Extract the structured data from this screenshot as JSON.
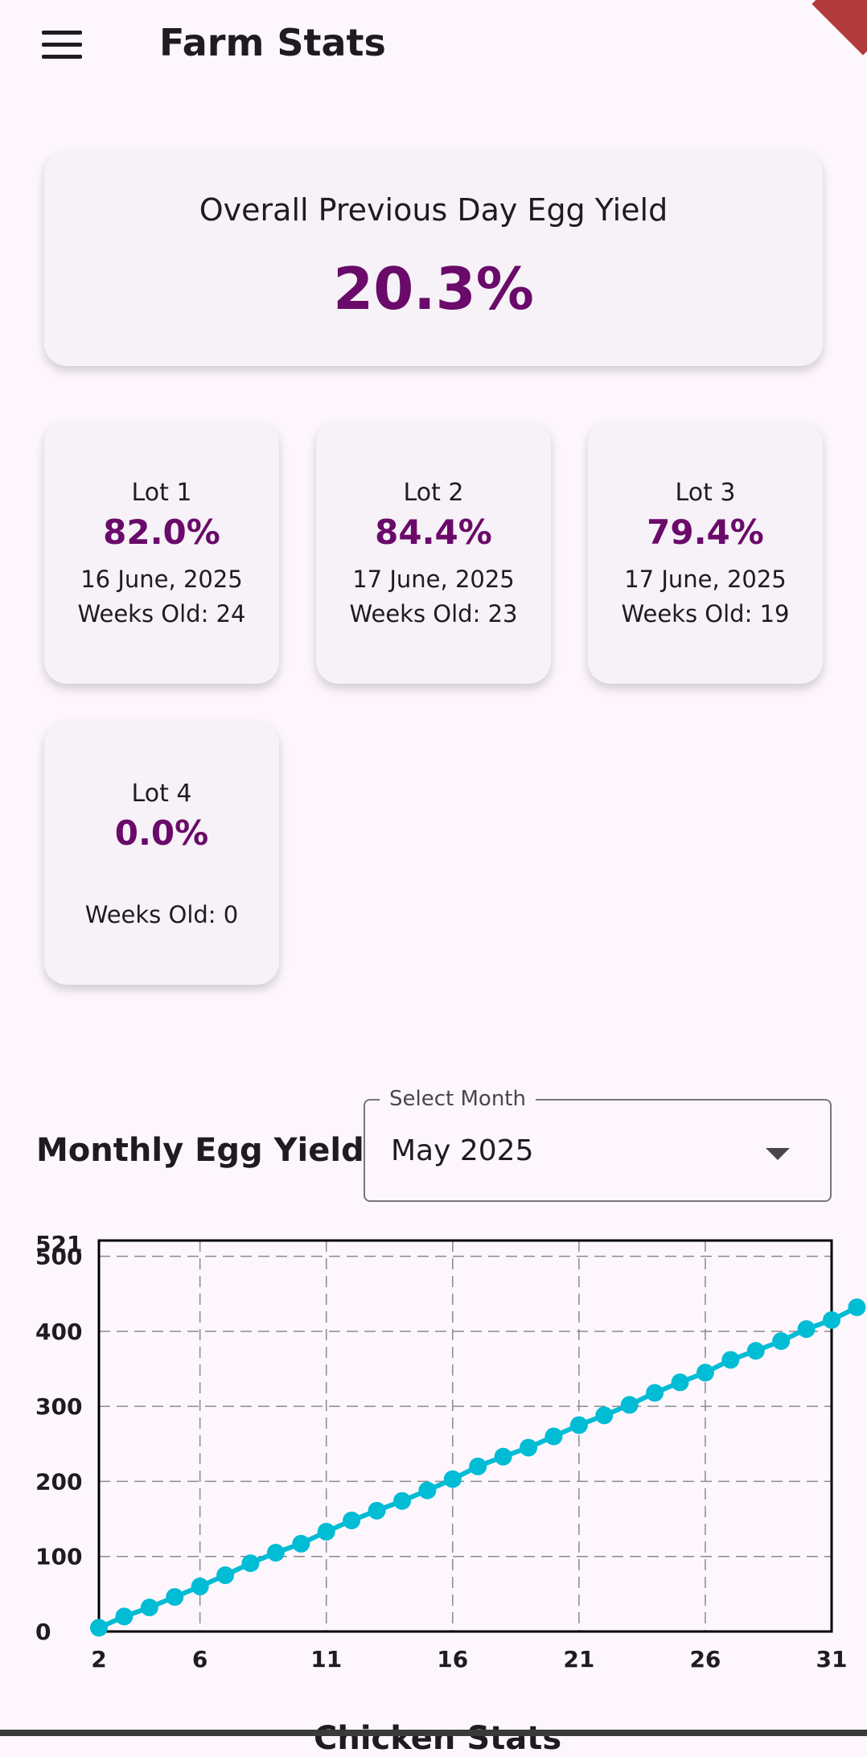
{
  "app": {
    "title": "Farm Stats",
    "menu_icon": "hamburger-menu-icon"
  },
  "overall": {
    "title": "Overall Previous Day Egg Yield",
    "value": "20.3%"
  },
  "lots": [
    {
      "title": "Lot 1",
      "value": "82.0%",
      "date": "16 June, 2025",
      "weeks": "Weeks Old: 24"
    },
    {
      "title": "Lot 2",
      "value": "84.4%",
      "date": "17 June, 2025",
      "weeks": "Weeks Old: 23"
    },
    {
      "title": "Lot 3",
      "value": "79.4%",
      "date": "17 June, 2025",
      "weeks": "Weeks Old: 19"
    },
    {
      "title": "Lot 4",
      "value": "0.0%",
      "date": "",
      "weeks": "Weeks Old: 0"
    }
  ],
  "monthly": {
    "title": "Monthly Egg Yield",
    "select_label": "Select Month",
    "selected_month": "May 2025"
  },
  "next_section": {
    "title": "Chicken Stats"
  },
  "colors": {
    "accent": "#6a0a6a",
    "series": "#00bcd4",
    "background": "#fdf7fd",
    "card": "#f6f2f7"
  },
  "chart_data": {
    "type": "line",
    "x": [
      2,
      3,
      4,
      5,
      6,
      7,
      8,
      9,
      10,
      11,
      12,
      13,
      14,
      15,
      16,
      17,
      18,
      19,
      20,
      21,
      22,
      23,
      24,
      25,
      26,
      27,
      28,
      29,
      30,
      31,
      32
    ],
    "values": [
      5,
      20,
      32,
      46,
      60,
      75,
      91,
      105,
      117,
      133,
      148,
      161,
      174,
      188,
      203,
      220,
      233,
      245,
      260,
      275,
      288,
      302,
      318,
      332,
      345,
      362,
      374,
      387,
      403,
      415,
      432
    ],
    "xticks": [
      2,
      6,
      11,
      16,
      21,
      26,
      31
    ],
    "yticks": [
      0,
      100,
      200,
      300,
      400,
      500
    ],
    "ymax_label": "521",
    "xlim": [
      2,
      31
    ],
    "ylim": [
      0,
      521
    ],
    "grid": true,
    "grid_style": "dashed"
  }
}
